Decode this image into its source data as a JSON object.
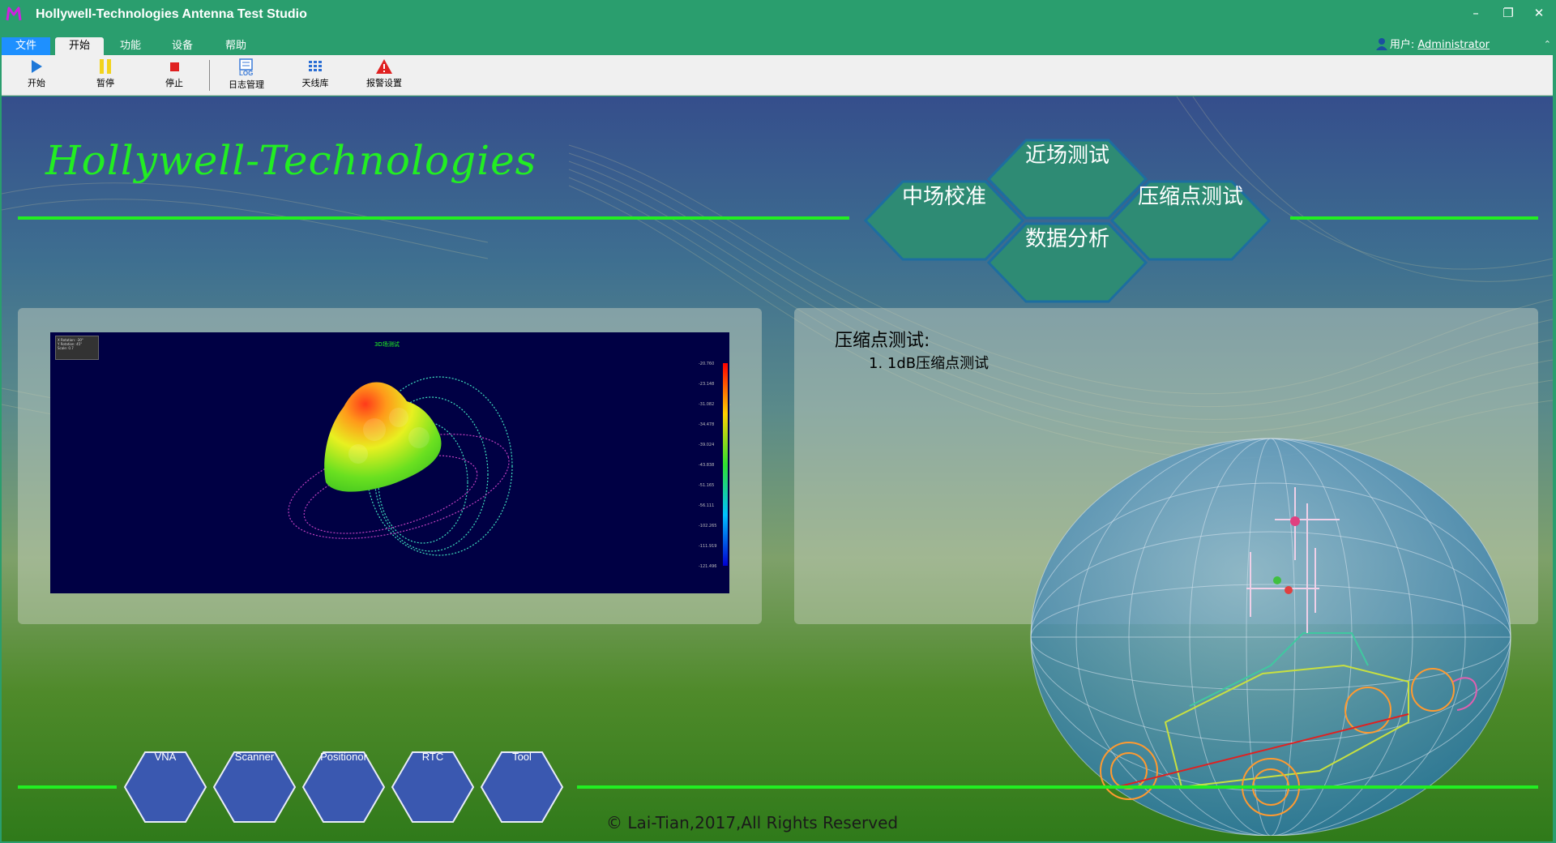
{
  "app": {
    "title": "Hollywell-Technologies Antenna Test Studio"
  },
  "window_controls": {
    "minimize": "–",
    "restore": "❐",
    "close": "✕"
  },
  "menu": {
    "tabs": [
      {
        "label": "文件",
        "active": false
      },
      {
        "label": "开始",
        "active": true
      },
      {
        "label": "功能",
        "active": false
      },
      {
        "label": "设备",
        "active": false
      },
      {
        "label": "帮助",
        "active": false
      }
    ],
    "user_prefix": "用户:",
    "user_name": "Administrator",
    "collapse": "⌃"
  },
  "toolbar": {
    "buttons": [
      {
        "label": "开始",
        "icon": "play-icon"
      },
      {
        "label": "暂停",
        "icon": "pause-icon"
      },
      {
        "label": "停止",
        "icon": "stop-icon"
      },
      {
        "label": "日志管理",
        "icon": "log-icon"
      },
      {
        "label": "天线库",
        "icon": "grid-icon"
      },
      {
        "label": "报警设置",
        "icon": "warning-icon"
      }
    ]
  },
  "brand": "Hollywell-Technologies",
  "feature_hexes": {
    "near_field": "近场测试",
    "mid_field": "中场校准",
    "compression": "压缩点测试",
    "analysis": "数据分析"
  },
  "plot": {
    "title": "3D场测试",
    "info_lines": [
      "X Rotation: -30°",
      "Y Rotation: 45°",
      "Scale: 0.7"
    ],
    "scale_labels": [
      "-20.760",
      "-23.148",
      "-31.082",
      "-34.478",
      "-39.024",
      "-43.838",
      "-51.165",
      "-56.111",
      "-102.265",
      "-111.919",
      "-121.496"
    ]
  },
  "description": {
    "title": "压缩点测试:",
    "items": [
      "1. 1dB压缩点测试"
    ]
  },
  "bottom_hexes": [
    "VNA",
    "Scanner",
    "Positionor",
    "RTC",
    "Tool"
  ],
  "copyright": "Lai-Tian,2017,All Rights Reserved",
  "colors": {
    "titlebar": "#2a9e6e",
    "accent_green": "#22ee22",
    "hex_large": "#2e8b74",
    "hex_small": "#3a58b0"
  }
}
